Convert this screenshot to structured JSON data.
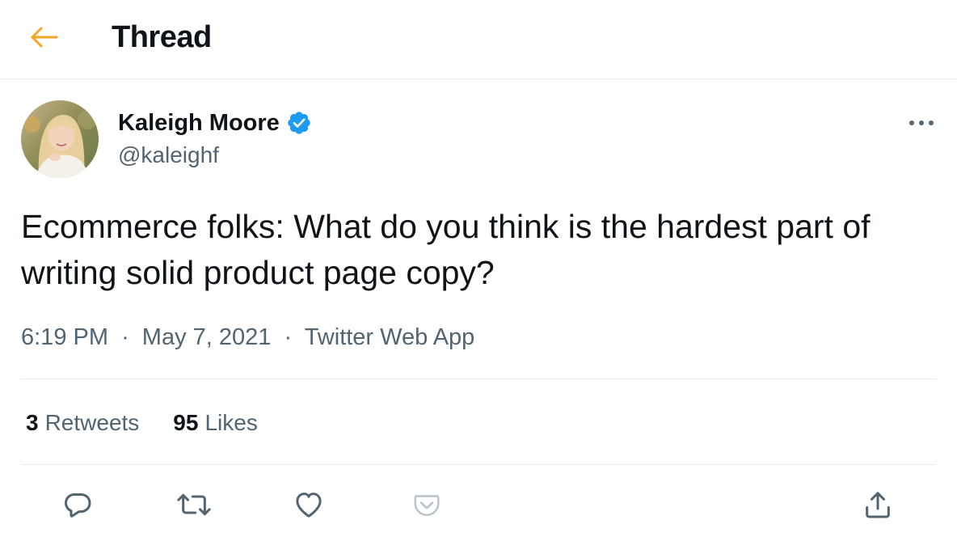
{
  "header": {
    "title": "Thread",
    "back_icon": "arrow-left-icon",
    "accent_color": "#f5a623"
  },
  "tweet": {
    "author": {
      "name": "Kaleigh Moore",
      "handle": "@kaleighf",
      "verified": true,
      "verified_color": "#1d9bf0",
      "avatar_icon": "user-avatar"
    },
    "text": "Ecommerce folks: What do you think is the hardest part of writing solid product page copy?",
    "time": "6:19 PM",
    "separator": "·",
    "date": "May 7, 2021",
    "source": "Twitter Web App",
    "stats": {
      "retweets_count": "3",
      "retweets_label": "Retweets",
      "likes_count": "95",
      "likes_label": "Likes"
    },
    "more_icon": "more-horizontal-icon",
    "actions": [
      {
        "name": "reply",
        "icon": "reply-icon"
      },
      {
        "name": "retweet",
        "icon": "retweet-icon"
      },
      {
        "name": "like",
        "icon": "heart-icon"
      },
      {
        "name": "save",
        "icon": "pocket-icon"
      },
      {
        "name": "share",
        "icon": "share-icon"
      }
    ]
  },
  "colors": {
    "text_primary": "#0f1419",
    "text_secondary": "#536471",
    "divider": "#e6ecf0",
    "pocket_accent": "#ee4056"
  }
}
